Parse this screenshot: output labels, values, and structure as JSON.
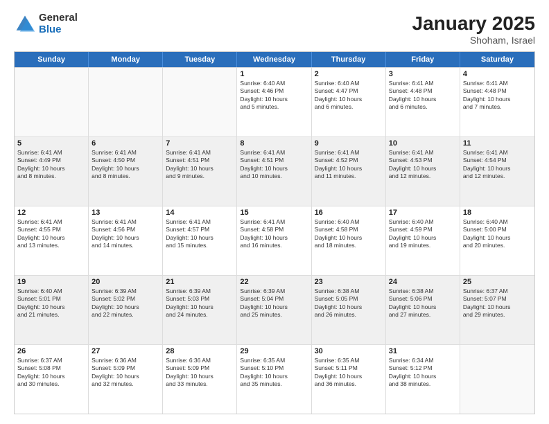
{
  "logo": {
    "general": "General",
    "blue": "Blue"
  },
  "title": {
    "month": "January 2025",
    "location": "Shoham, Israel"
  },
  "header": {
    "days": [
      "Sunday",
      "Monday",
      "Tuesday",
      "Wednesday",
      "Thursday",
      "Friday",
      "Saturday"
    ]
  },
  "weeks": [
    [
      {
        "day": "",
        "info": ""
      },
      {
        "day": "",
        "info": ""
      },
      {
        "day": "",
        "info": ""
      },
      {
        "day": "1",
        "info": "Sunrise: 6:40 AM\nSunset: 4:46 PM\nDaylight: 10 hours\nand 5 minutes."
      },
      {
        "day": "2",
        "info": "Sunrise: 6:40 AM\nSunset: 4:47 PM\nDaylight: 10 hours\nand 6 minutes."
      },
      {
        "day": "3",
        "info": "Sunrise: 6:41 AM\nSunset: 4:48 PM\nDaylight: 10 hours\nand 6 minutes."
      },
      {
        "day": "4",
        "info": "Sunrise: 6:41 AM\nSunset: 4:48 PM\nDaylight: 10 hours\nand 7 minutes."
      }
    ],
    [
      {
        "day": "5",
        "info": "Sunrise: 6:41 AM\nSunset: 4:49 PM\nDaylight: 10 hours\nand 8 minutes."
      },
      {
        "day": "6",
        "info": "Sunrise: 6:41 AM\nSunset: 4:50 PM\nDaylight: 10 hours\nand 8 minutes."
      },
      {
        "day": "7",
        "info": "Sunrise: 6:41 AM\nSunset: 4:51 PM\nDaylight: 10 hours\nand 9 minutes."
      },
      {
        "day": "8",
        "info": "Sunrise: 6:41 AM\nSunset: 4:51 PM\nDaylight: 10 hours\nand 10 minutes."
      },
      {
        "day": "9",
        "info": "Sunrise: 6:41 AM\nSunset: 4:52 PM\nDaylight: 10 hours\nand 11 minutes."
      },
      {
        "day": "10",
        "info": "Sunrise: 6:41 AM\nSunset: 4:53 PM\nDaylight: 10 hours\nand 12 minutes."
      },
      {
        "day": "11",
        "info": "Sunrise: 6:41 AM\nSunset: 4:54 PM\nDaylight: 10 hours\nand 12 minutes."
      }
    ],
    [
      {
        "day": "12",
        "info": "Sunrise: 6:41 AM\nSunset: 4:55 PM\nDaylight: 10 hours\nand 13 minutes."
      },
      {
        "day": "13",
        "info": "Sunrise: 6:41 AM\nSunset: 4:56 PM\nDaylight: 10 hours\nand 14 minutes."
      },
      {
        "day": "14",
        "info": "Sunrise: 6:41 AM\nSunset: 4:57 PM\nDaylight: 10 hours\nand 15 minutes."
      },
      {
        "day": "15",
        "info": "Sunrise: 6:41 AM\nSunset: 4:58 PM\nDaylight: 10 hours\nand 16 minutes."
      },
      {
        "day": "16",
        "info": "Sunrise: 6:40 AM\nSunset: 4:58 PM\nDaylight: 10 hours\nand 18 minutes."
      },
      {
        "day": "17",
        "info": "Sunrise: 6:40 AM\nSunset: 4:59 PM\nDaylight: 10 hours\nand 19 minutes."
      },
      {
        "day": "18",
        "info": "Sunrise: 6:40 AM\nSunset: 5:00 PM\nDaylight: 10 hours\nand 20 minutes."
      }
    ],
    [
      {
        "day": "19",
        "info": "Sunrise: 6:40 AM\nSunset: 5:01 PM\nDaylight: 10 hours\nand 21 minutes."
      },
      {
        "day": "20",
        "info": "Sunrise: 6:39 AM\nSunset: 5:02 PM\nDaylight: 10 hours\nand 22 minutes."
      },
      {
        "day": "21",
        "info": "Sunrise: 6:39 AM\nSunset: 5:03 PM\nDaylight: 10 hours\nand 24 minutes."
      },
      {
        "day": "22",
        "info": "Sunrise: 6:39 AM\nSunset: 5:04 PM\nDaylight: 10 hours\nand 25 minutes."
      },
      {
        "day": "23",
        "info": "Sunrise: 6:38 AM\nSunset: 5:05 PM\nDaylight: 10 hours\nand 26 minutes."
      },
      {
        "day": "24",
        "info": "Sunrise: 6:38 AM\nSunset: 5:06 PM\nDaylight: 10 hours\nand 27 minutes."
      },
      {
        "day": "25",
        "info": "Sunrise: 6:37 AM\nSunset: 5:07 PM\nDaylight: 10 hours\nand 29 minutes."
      }
    ],
    [
      {
        "day": "26",
        "info": "Sunrise: 6:37 AM\nSunset: 5:08 PM\nDaylight: 10 hours\nand 30 minutes."
      },
      {
        "day": "27",
        "info": "Sunrise: 6:36 AM\nSunset: 5:09 PM\nDaylight: 10 hours\nand 32 minutes."
      },
      {
        "day": "28",
        "info": "Sunrise: 6:36 AM\nSunset: 5:09 PM\nDaylight: 10 hours\nand 33 minutes."
      },
      {
        "day": "29",
        "info": "Sunrise: 6:35 AM\nSunset: 5:10 PM\nDaylight: 10 hours\nand 35 minutes."
      },
      {
        "day": "30",
        "info": "Sunrise: 6:35 AM\nSunset: 5:11 PM\nDaylight: 10 hours\nand 36 minutes."
      },
      {
        "day": "31",
        "info": "Sunrise: 6:34 AM\nSunset: 5:12 PM\nDaylight: 10 hours\nand 38 minutes."
      },
      {
        "day": "",
        "info": ""
      }
    ]
  ]
}
